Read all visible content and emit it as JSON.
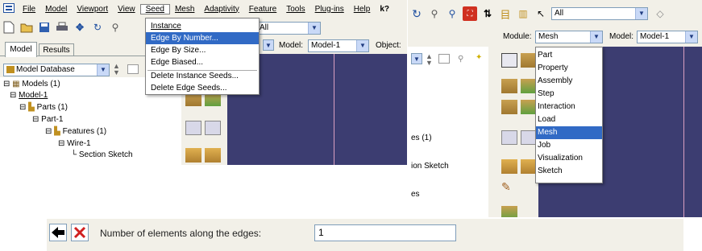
{
  "left_window": {
    "menu": [
      "File",
      "Model",
      "Viewport",
      "View",
      "Seed",
      "Mesh",
      "Adaptivity",
      "Feature",
      "Tools",
      "Plug-ins",
      "Help",
      "k?"
    ],
    "seed_menu": [
      "Instance",
      "Edge By Number...",
      "Edge By Size...",
      "Edge Biased...",
      "Delete Instance Seeds...",
      "Delete Edge Seeds..."
    ],
    "seed_menu_selected": "Edge By Number...",
    "selection_filter": "All",
    "tabs": [
      "Model",
      "Results"
    ],
    "model_db_combo": "Model Database",
    "model_label": "Model:",
    "model_value": "Model-1",
    "object_label": "Object:",
    "tree": [
      "Models (1)",
      "Model-1",
      "Parts (1)",
      "Part-1",
      "Features (1)",
      "Wire-1",
      "Section Sketch"
    ]
  },
  "right_window": {
    "selection_filter": "All",
    "module_label": "Module:",
    "module_value": "Mesh",
    "model_label": "Model:",
    "model_value": "Model-1",
    "module_options": [
      "Part",
      "Property",
      "Assembly",
      "Step",
      "Interaction",
      "Load",
      "Mesh",
      "Job",
      "Visualization",
      "Sketch"
    ],
    "module_selected": "Mesh",
    "tree_fragments": [
      "es (1)",
      "ion Sketch",
      "es"
    ]
  },
  "prompt": {
    "label": "Number of elements along the edges:",
    "value": "1"
  },
  "colors": {
    "viewport_bg": "#3c3d71",
    "selection_bg": "#316ac5",
    "toolbar_bg": "#f2f0e8"
  }
}
